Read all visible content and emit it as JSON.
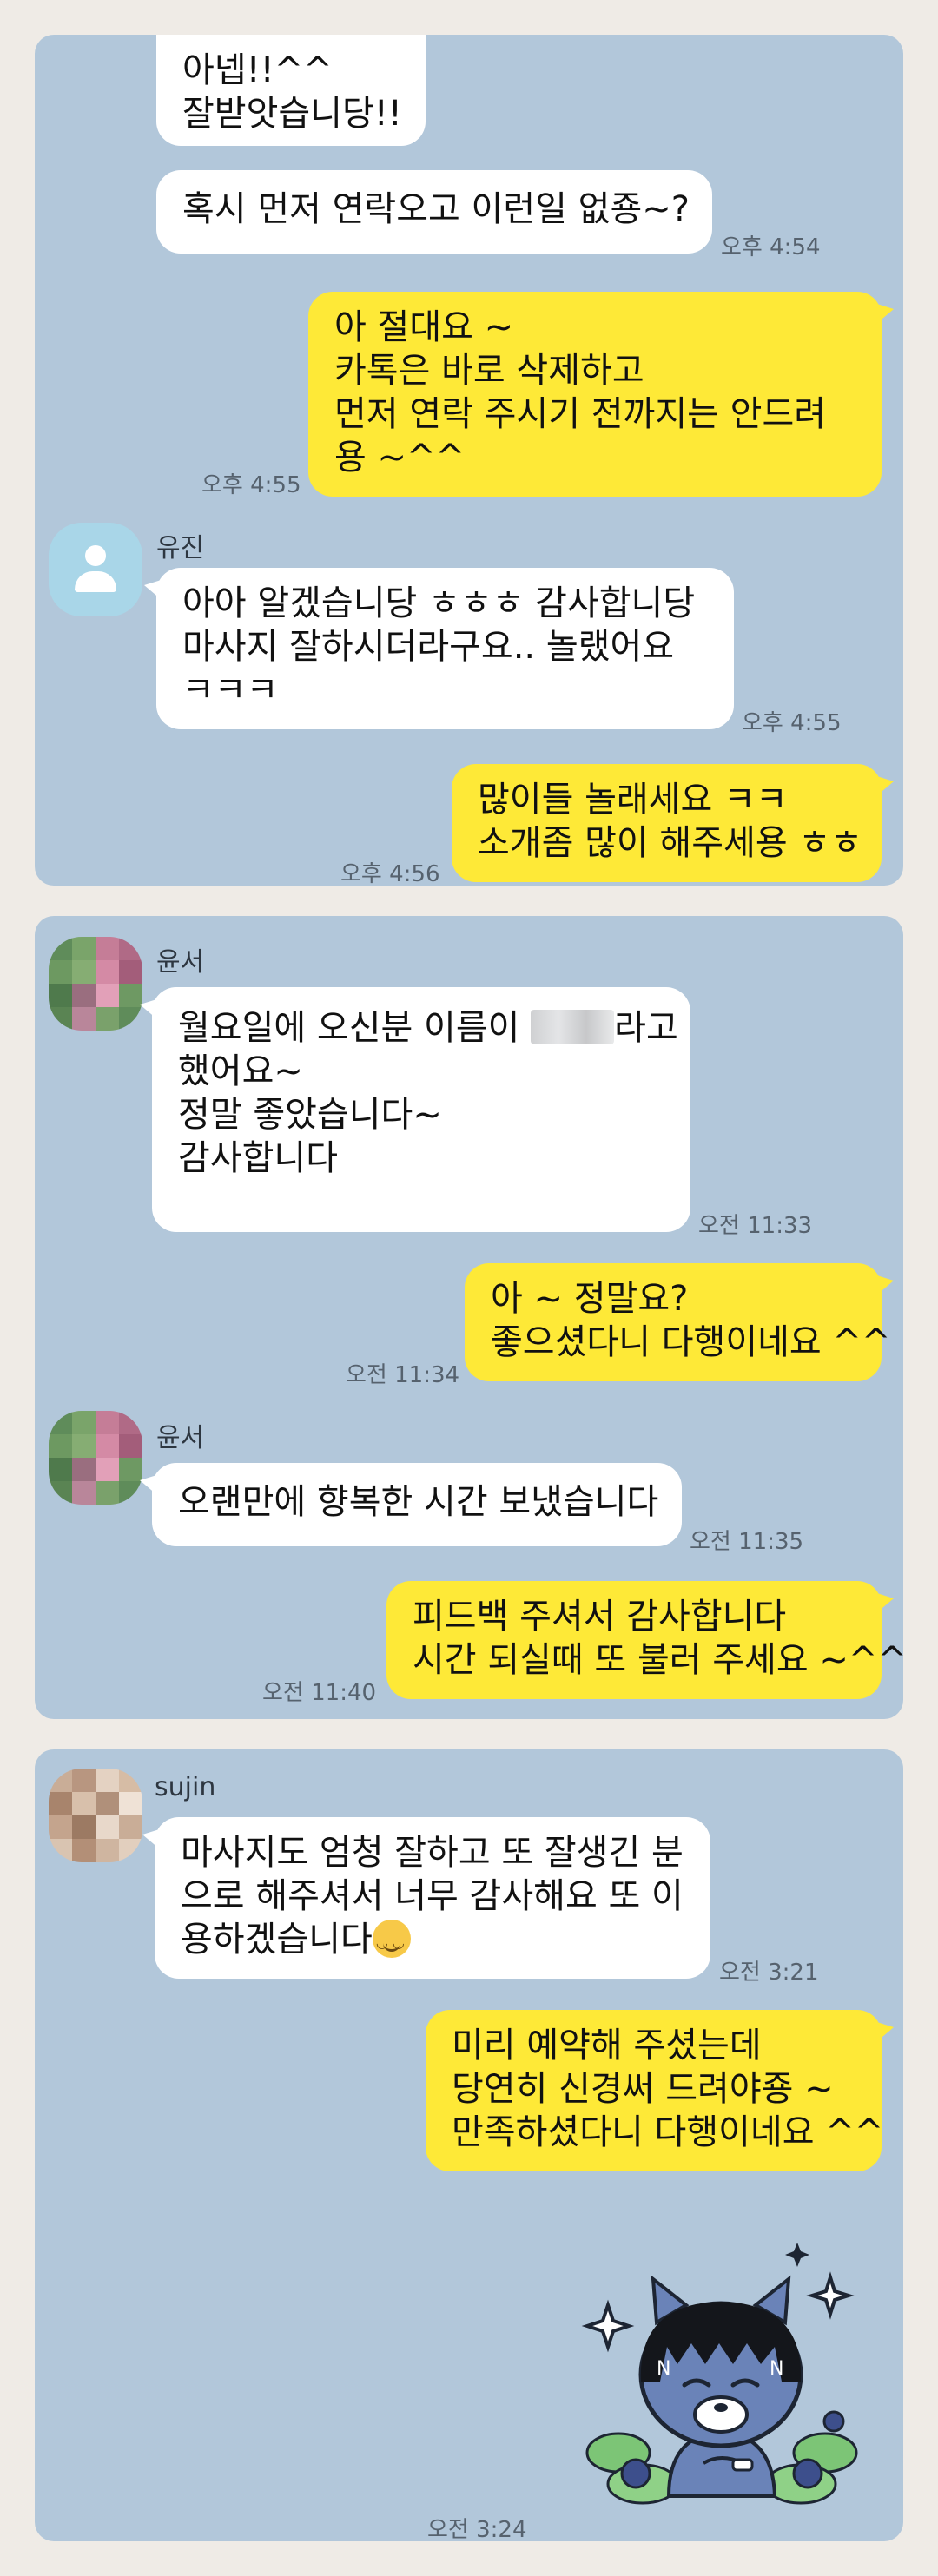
{
  "panel1": {
    "m1": {
      "lines": [
        "아넵!!^^",
        "잘받앗습니당!!"
      ]
    },
    "m2": {
      "lines": [
        "혹시 먼저 연락오고 이런일 없죵~?"
      ],
      "time": "오후 4:54"
    },
    "m3": {
      "lines": [
        "아 절대요 ~",
        "카톡은 바로 삭제하고",
        "먼저 연락 주시기 전까지는 안드려",
        "용 ~^^"
      ],
      "time": "오후 4:55"
    },
    "m4": {
      "name": "유진",
      "lines": [
        "아아 알겠습니당 ㅎㅎㅎ 감사합니당",
        "마사지 잘하시더라구요.. 놀랬어요",
        "ㅋㅋㅋ"
      ],
      "time": "오후 4:55"
    },
    "m5": {
      "lines": [
        "많이들 놀래세요 ㅋㅋ",
        "소개좀 많이 해주세용 ㅎㅎ"
      ],
      "time": "오후 4:56"
    }
  },
  "panel2": {
    "m1": {
      "name": "윤서",
      "line1_pre": "월요일에 오신분 이름이 ",
      "line1_post": "라고",
      "lines": [
        "했어요~",
        "정말 좋았습니다~",
        "감사합니다"
      ],
      "time": "오전 11:33"
    },
    "m2": {
      "lines": [
        "아 ~ 정말요?",
        "좋으셨다니 다행이네요 ^^"
      ],
      "time": "오전 11:34"
    },
    "m3": {
      "name": "윤서",
      "lines": [
        "오랜만에 향복한 시간 보냈습니다"
      ],
      "time": "오전 11:35"
    },
    "m4": {
      "lines": [
        "피드백 주셔서 감사합니다",
        "시간 되실때 또 불러 주세요 ~^^"
      ],
      "time": "오전 11:40"
    }
  },
  "panel3": {
    "m1": {
      "name": "sujin",
      "lines": [
        "마사지도 엄청 잘하고 또 잘생긴 분",
        "으로 해주셔서 너무 감사해요 또 이"
      ],
      "line3": "용하겠습니다",
      "time": "오전 3:21"
    },
    "m2": {
      "lines": [
        "미리 예약해 주셨는데",
        "당연히 신경써 드려야죵 ~",
        "만족하셨다니 다행이네요 ^^"
      ]
    },
    "sticker": {
      "name": "ryan-bear-sticker-icon"
    },
    "time_last": "오전 3:24"
  },
  "colors": {
    "chat_bg": "#b2c7da",
    "incoming": "#ffffff",
    "outgoing": "#fee937",
    "page_bg": "#efebe6"
  }
}
